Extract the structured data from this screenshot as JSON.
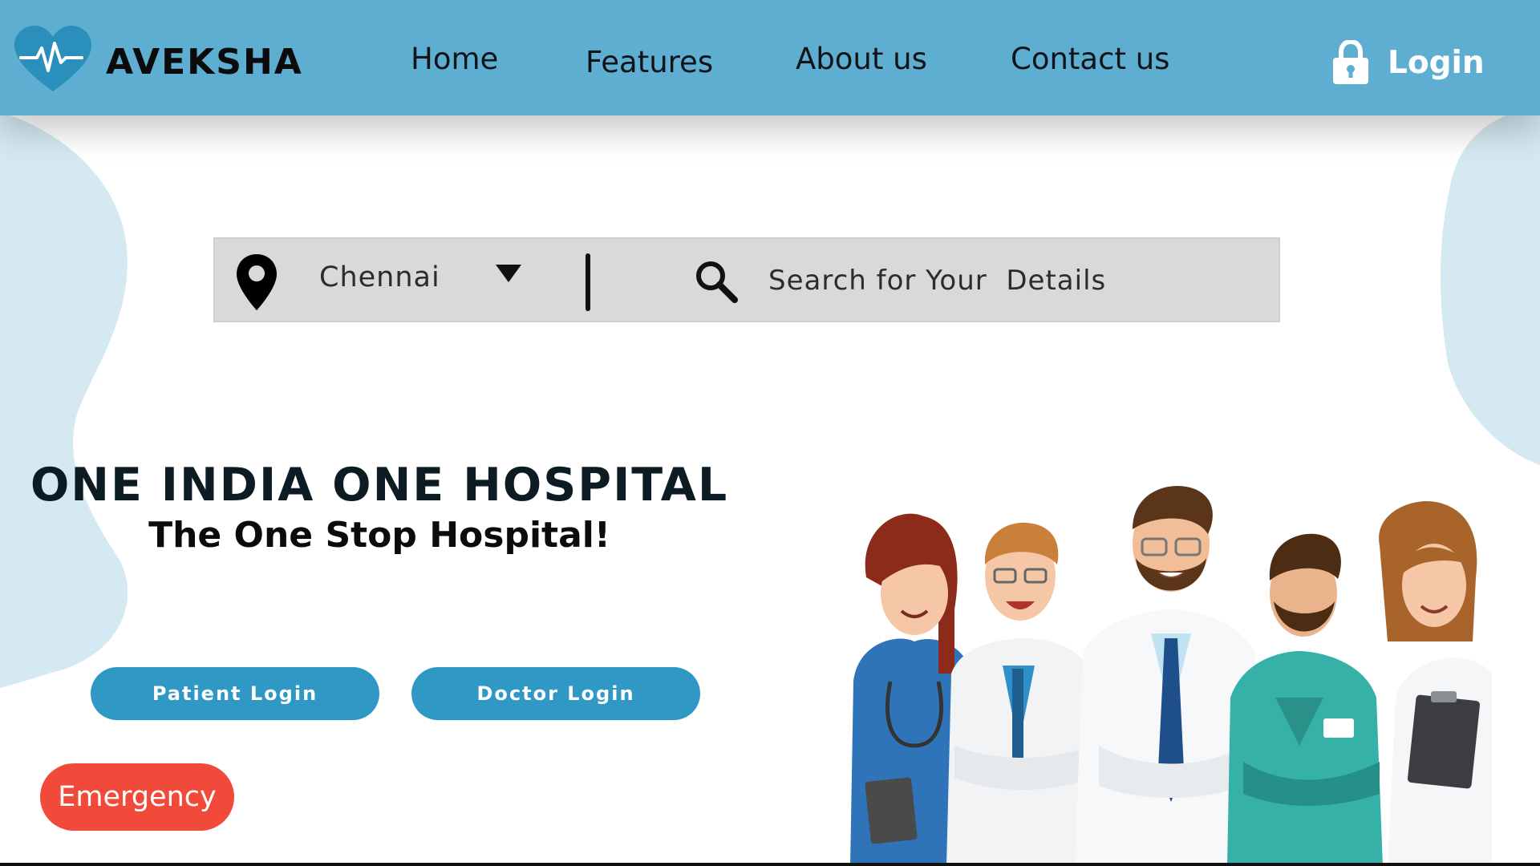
{
  "brand": {
    "name": "AVEKSHA",
    "logo_icon": "heart-pulse-icon",
    "color": "#5eaed2"
  },
  "nav": {
    "items": [
      {
        "label": "Home"
      },
      {
        "label": "Features"
      },
      {
        "label": "About us"
      },
      {
        "label": "Contact us"
      }
    ],
    "login_label": "Login",
    "login_icon": "lock-icon"
  },
  "search": {
    "location_icon": "location-pin-icon",
    "city": "Chennai",
    "dropdown_icon": "caret-down-icon",
    "search_icon": "magnifier-icon",
    "placeholder": "Search for Your  Details"
  },
  "hero": {
    "title": "ONE INDIA ONE HOSPITAL",
    "subtitle": "The One Stop Hospital!"
  },
  "buttons": {
    "patient_login": "Patient Login",
    "doctor_login": "Doctor Login",
    "emergency": "Emergency"
  },
  "colors": {
    "header": "#5eaed2",
    "button": "#2f98c4",
    "emergency": "#f24a3a",
    "search_bg": "#d9d9d9"
  }
}
